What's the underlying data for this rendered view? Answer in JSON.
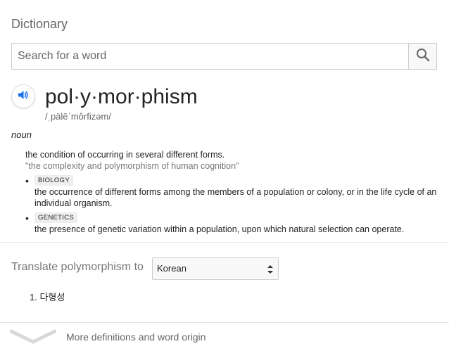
{
  "card": {
    "title": "Dictionary"
  },
  "search": {
    "placeholder": "Search for a word",
    "value": ""
  },
  "entry": {
    "word": "pol·y·mor·phism",
    "phonetic": "/ˌpälēˈmôrfizəm/",
    "part_of_speech": "noun",
    "definition": "the condition of occurring in several different forms.",
    "example": "\"the complexity and polymorphism of human cognition\"",
    "senses": [
      {
        "label": "BIOLOGY",
        "definition": "the occurrence of different forms among the members of a population or colony, or in the life cycle of an individual organism."
      },
      {
        "label": "GENETICS",
        "definition": "the presence of genetic variation within a population, upon which natural selection can operate."
      }
    ]
  },
  "translate": {
    "label": "Translate polymorphism to",
    "selected_language": "Korean",
    "results": [
      "1. 다형성"
    ]
  },
  "footer": {
    "more_label": "More definitions and word origin"
  },
  "colors": {
    "accent_blue": "#1a73e8",
    "chip_bg": "#eeeeee",
    "muted_text": "#777777"
  },
  "icons": {
    "search": "search-icon",
    "speaker": "speaker-icon",
    "chevron": "chevron-down-icon"
  }
}
